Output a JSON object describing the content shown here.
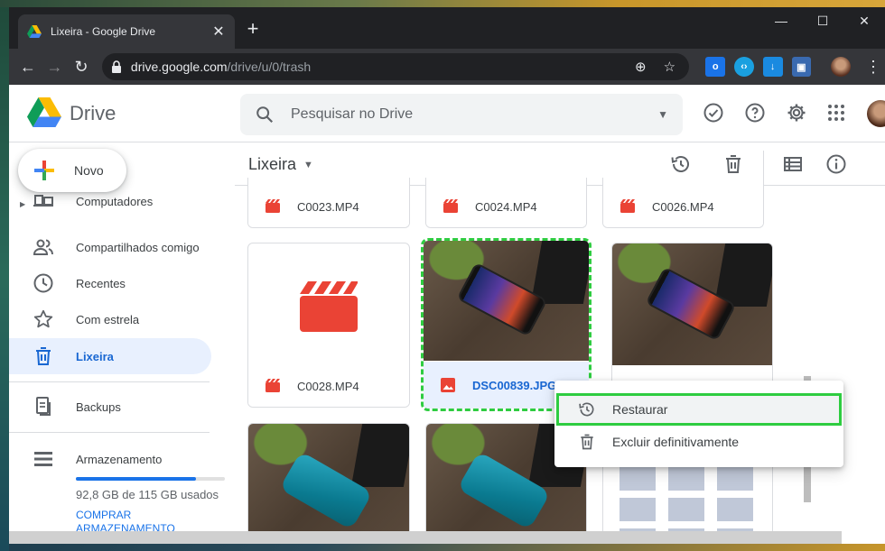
{
  "browser": {
    "tab_title": "Lixeira - Google Drive",
    "url_host": "drive.google.com",
    "url_path": "/drive/u/0/trash"
  },
  "drive": {
    "product_name": "Drive",
    "search_placeholder": "Pesquisar no Drive"
  },
  "sidebar": {
    "new_label": "Novo",
    "items": [
      {
        "label": "Computadores",
        "icon": "computer-icon"
      },
      {
        "label": "Compartilhados comigo",
        "icon": "shared-people-icon"
      },
      {
        "label": "Recentes",
        "icon": "clock-icon"
      },
      {
        "label": "Com estrela",
        "icon": "star-icon"
      },
      {
        "label": "Lixeira",
        "icon": "trash-icon",
        "active": true
      },
      {
        "label": "Backups",
        "icon": "backup-icon"
      },
      {
        "label": "Armazenamento",
        "icon": "storage-icon"
      }
    ],
    "storage_text": "92,8 GB de 115 GB usados",
    "storage_used_fraction": 0.807,
    "buy_storage": "COMPRAR ARMAZENAMENTO"
  },
  "main": {
    "breadcrumb": "Lixeira",
    "files": [
      {
        "name": "C0023.MP4",
        "type": "video"
      },
      {
        "name": "C0024.MP4",
        "type": "video"
      },
      {
        "name": "C0026.MP4",
        "type": "video"
      },
      {
        "name": "C0028.MP4",
        "type": "video"
      },
      {
        "name": "DSC00839.JPG",
        "type": "image",
        "selected": true
      }
    ]
  },
  "context_menu": {
    "restore": "Restaurar",
    "delete_forever": "Excluir definitivamente"
  },
  "colors": {
    "accent": "#1a73e8",
    "highlight": "#2ecc40",
    "video_red": "#ea4335"
  }
}
